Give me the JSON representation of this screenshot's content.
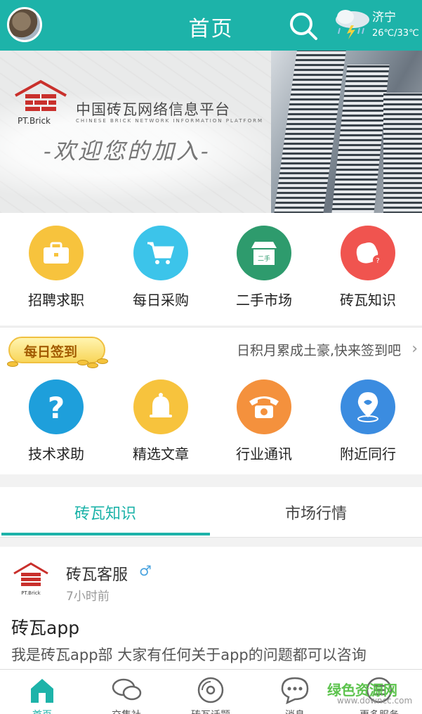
{
  "colors": {
    "accent": "#1db3a9",
    "header_bg": "#1db3a9"
  },
  "header": {
    "title": "首页",
    "city": "济宁",
    "temperature": "26℃/33℃",
    "icons": [
      "avatar",
      "search-icon",
      "weather-icon"
    ]
  },
  "banner": {
    "brand_name": "中国砖瓦网络信息平台",
    "brand_en": "CHINESE BRICK NETWORK INFORMATION PLATFORM",
    "logo_text": "PT.Brick",
    "welcome": "-欢迎您的加入-"
  },
  "grid1": [
    {
      "label": "招聘求职",
      "icon": "briefcase-icon",
      "color": "#f7c33d"
    },
    {
      "label": "每日采购",
      "icon": "cart-icon",
      "color": "#3cc4ea"
    },
    {
      "label": "二手市场",
      "icon": "shop-icon",
      "color": "#2e9b6d"
    },
    {
      "label": "砖瓦知识",
      "icon": "knowledge-icon",
      "color": "#f0544f"
    }
  ],
  "signin": {
    "badge": "每日签到",
    "text": "日积月累成土豪,快来签到吧"
  },
  "grid2": [
    {
      "label": "技术求助",
      "icon": "question-icon",
      "color": "#1e9fdb"
    },
    {
      "label": "精选文章",
      "icon": "bell-icon",
      "color": "#f7c33d"
    },
    {
      "label": "行业通讯",
      "icon": "phone-icon",
      "color": "#f4913d"
    },
    {
      "label": "附近同行",
      "icon": "location-icon",
      "color": "#3b8ce0"
    }
  ],
  "tabs": [
    {
      "label": "砖瓦知识",
      "active": true
    },
    {
      "label": "市场行情",
      "active": false
    }
  ],
  "post": {
    "author": "砖瓦客服",
    "gender": "♂",
    "time": "7小时前",
    "title": "砖瓦app",
    "body": "我是砖瓦app部  大家有任何关于app的问题都可以咨询",
    "logo_text": "PT.Brick"
  },
  "bottom_nav": [
    {
      "label": "首页",
      "icon": "home-icon",
      "active": true
    },
    {
      "label": "交集社",
      "icon": "chat-icon",
      "active": false
    },
    {
      "label": "砖瓦话题",
      "icon": "disc-icon",
      "active": false
    },
    {
      "label": "消息",
      "icon": "message-icon",
      "active": false
    },
    {
      "label": "更多服务",
      "icon": "more-icon",
      "active": false
    }
  ],
  "watermark": {
    "text": "绿色资源网",
    "url": "www.downcc.com"
  }
}
